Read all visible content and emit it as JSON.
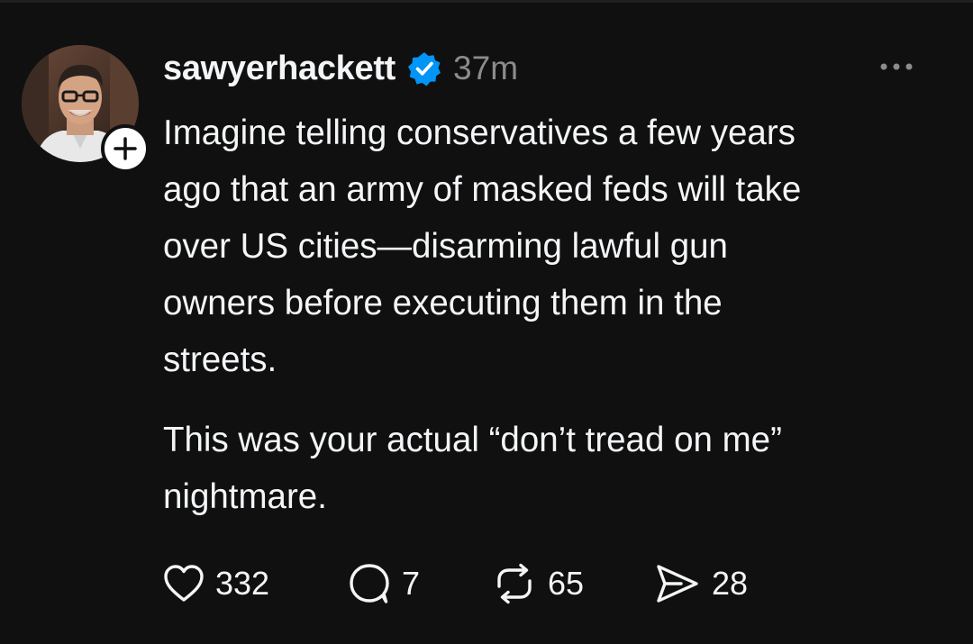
{
  "post": {
    "author": {
      "username": "sawyerhackett",
      "verified_icon": "verified-badge-icon",
      "timestamp": "37m"
    },
    "body": {
      "paragraph_1_lines": [
        "Imagine telling conservatives a few years",
        "ago that an army of masked feds will take",
        "over US cities—disarming lawful gun",
        "owners before executing them in the",
        "streets."
      ],
      "paragraph_2_lines": [
        "This was your actual “don’t tread on me”",
        "nightmare."
      ]
    },
    "actions": {
      "likes": "332",
      "replies": "7",
      "reposts": "65",
      "shares": "28"
    },
    "colors": {
      "background": "#101010",
      "text": "#f3f5f7",
      "muted": "#8c8c8c",
      "verified_blue": "#0095f6"
    }
  }
}
